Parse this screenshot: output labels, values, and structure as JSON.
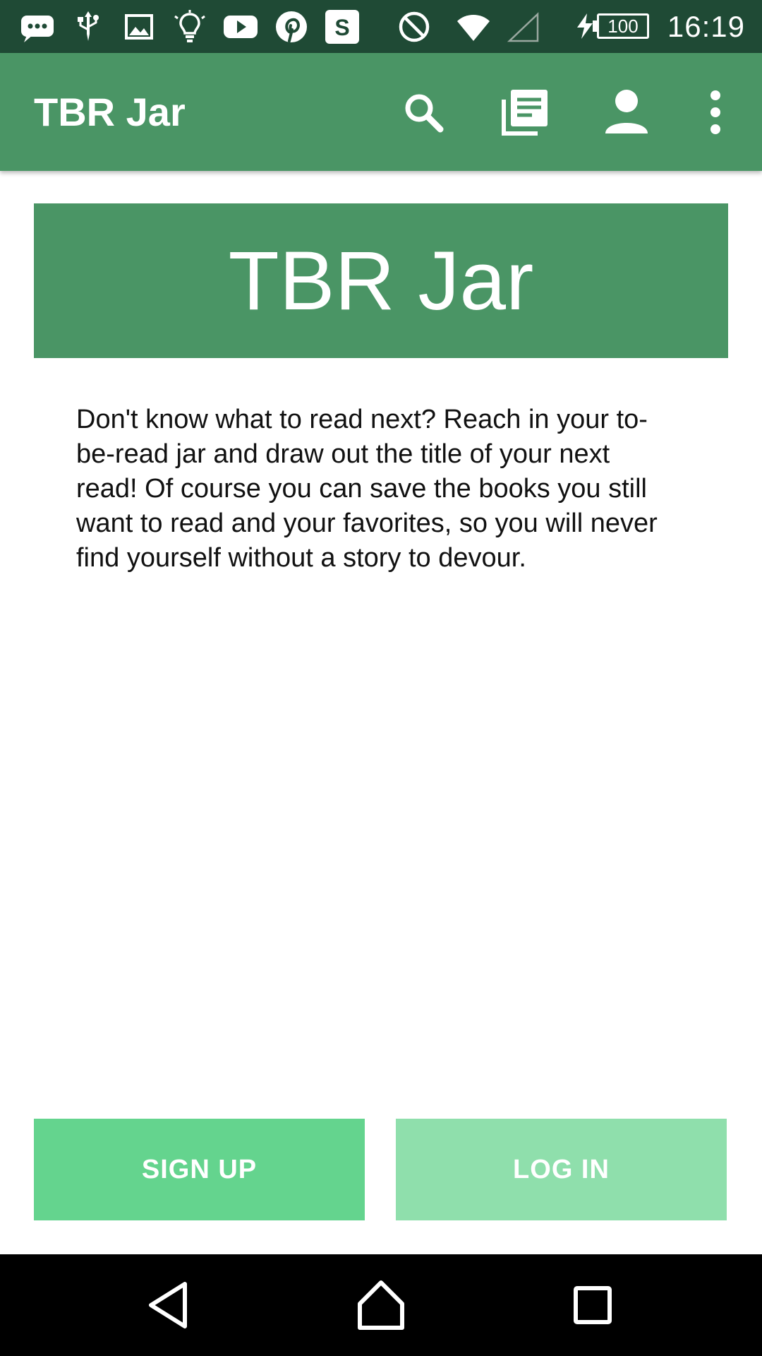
{
  "status_bar": {
    "icons": [
      "messages-icon",
      "usb-icon",
      "gallery-icon",
      "lightbulb-icon",
      "youtube-icon",
      "pinterest-icon",
      "s-app-icon",
      "do-not-disturb-icon",
      "wifi-icon",
      "cell-signal-icon",
      "charging-icon"
    ],
    "s_app_letter": "S",
    "battery_level": "100",
    "time": "16:19"
  },
  "app_bar": {
    "title": "TBR Jar",
    "actions": [
      "search-icon",
      "library-icon",
      "account-icon",
      "overflow-menu-icon"
    ]
  },
  "banner": {
    "title": "TBR Jar"
  },
  "description": "Don't know what to read next? Reach in your to-be-read jar and draw out the title of your next read! Of course you can save the books you still want to read and your favorites, so you will never find yourself without a story to devour.",
  "buttons": {
    "signup": "SIGN UP",
    "login": "LOG IN"
  },
  "nav_bar": {
    "buttons": [
      "back-icon",
      "home-icon",
      "recents-icon"
    ]
  },
  "colors": {
    "status_bar": "#1f4a35",
    "primary": "#4a9565",
    "signup_button": "#64d48e",
    "login_button": "#8fdfac",
    "nav_bar": "#000000"
  }
}
